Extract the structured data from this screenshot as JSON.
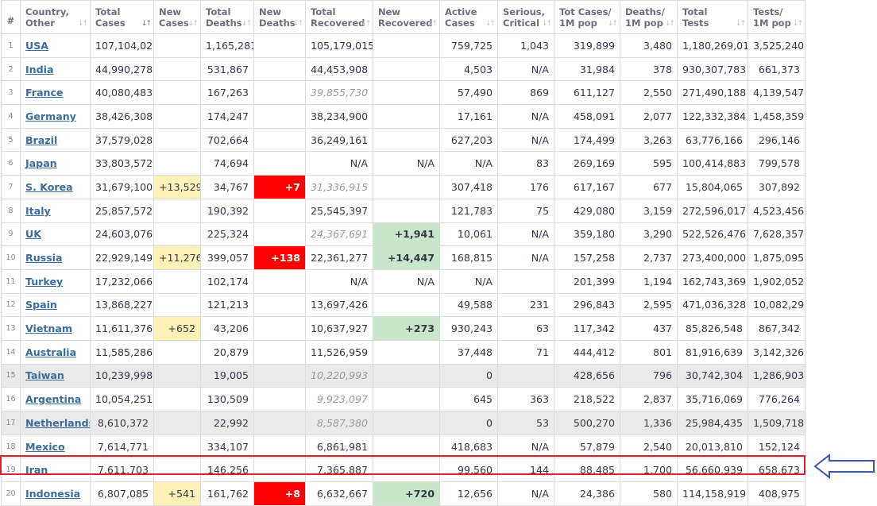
{
  "headers": [
    {
      "label": "#",
      "sortable": false
    },
    {
      "label": "Country,\nOther",
      "sortable": true
    },
    {
      "label": "Total\nCases",
      "sortable": true,
      "sorted": true
    },
    {
      "label": "New\nCases",
      "sortable": true
    },
    {
      "label": "Total\nDeaths",
      "sortable": true
    },
    {
      "label": "New\nDeaths",
      "sortable": true
    },
    {
      "label": "Total\nRecovered",
      "sortable": true
    },
    {
      "label": "New\nRecovered",
      "sortable": true
    },
    {
      "label": "Active\nCases",
      "sortable": true
    },
    {
      "label": "Serious,\nCritical",
      "sortable": true
    },
    {
      "label": "Tot Cases/\n1M pop",
      "sortable": true
    },
    {
      "label": "Deaths/\n1M pop",
      "sortable": true
    },
    {
      "label": "Total\nTests",
      "sortable": true
    },
    {
      "label": "Tests/\n1M pop",
      "sortable": true
    }
  ],
  "sort_icon": "sort-arrows-icon",
  "rows": [
    {
      "num": "1",
      "country": "USA",
      "total_cases": "107,104,021",
      "new_cases": "",
      "total_deaths": "1,165,281",
      "new_deaths": "",
      "total_recovered": "105,179,015",
      "rec_italic": false,
      "new_recovered": "",
      "active_cases": "759,725",
      "serious": "1,043",
      "cases_1m": "319,899",
      "deaths_1m": "3,480",
      "total_tests": "1,180,269,015",
      "tests_1m": "3,525,240",
      "grey": false
    },
    {
      "num": "2",
      "country": "India",
      "total_cases": "44,990,278",
      "new_cases": "",
      "total_deaths": "531,867",
      "new_deaths": "",
      "total_recovered": "44,453,908",
      "rec_italic": false,
      "new_recovered": "",
      "active_cases": "4,503",
      "serious": "N/A",
      "cases_1m": "31,984",
      "deaths_1m": "378",
      "total_tests": "930,307,783",
      "tests_1m": "661,373",
      "grey": false
    },
    {
      "num": "3",
      "country": "France",
      "total_cases": "40,080,483",
      "new_cases": "",
      "total_deaths": "167,263",
      "new_deaths": "",
      "total_recovered": "39,855,730",
      "rec_italic": true,
      "new_recovered": "",
      "active_cases": "57,490",
      "serious": "869",
      "cases_1m": "611,127",
      "deaths_1m": "2,550",
      "total_tests": "271,490,188",
      "tests_1m": "4,139,547",
      "grey": false
    },
    {
      "num": "4",
      "country": "Germany",
      "total_cases": "38,426,308",
      "new_cases": "",
      "total_deaths": "174,247",
      "new_deaths": "",
      "total_recovered": "38,234,900",
      "rec_italic": false,
      "new_recovered": "",
      "active_cases": "17,161",
      "serious": "N/A",
      "cases_1m": "458,091",
      "deaths_1m": "2,077",
      "total_tests": "122,332,384",
      "tests_1m": "1,458,359",
      "grey": false
    },
    {
      "num": "5",
      "country": "Brazil",
      "total_cases": "37,579,028",
      "new_cases": "",
      "total_deaths": "702,664",
      "new_deaths": "",
      "total_recovered": "36,249,161",
      "rec_italic": false,
      "new_recovered": "",
      "active_cases": "627,203",
      "serious": "N/A",
      "cases_1m": "174,499",
      "deaths_1m": "3,263",
      "total_tests": "63,776,166",
      "tests_1m": "296,146",
      "grey": false
    },
    {
      "num": "6",
      "country": "Japan",
      "total_cases": "33,803,572",
      "new_cases": "",
      "total_deaths": "74,694",
      "new_deaths": "",
      "total_recovered": "N/A",
      "rec_italic": false,
      "new_recovered": "N/A",
      "active_cases": "N/A",
      "serious": "83",
      "cases_1m": "269,169",
      "deaths_1m": "595",
      "total_tests": "100,414,883",
      "tests_1m": "799,578",
      "grey": false
    },
    {
      "num": "7",
      "country": "S. Korea",
      "total_cases": "31,679,100",
      "new_cases": "+13,529",
      "total_deaths": "34,767",
      "new_deaths": "+7",
      "total_recovered": "31,336,915",
      "rec_italic": true,
      "new_recovered": "",
      "active_cases": "307,418",
      "serious": "176",
      "cases_1m": "617,167",
      "deaths_1m": "677",
      "total_tests": "15,804,065",
      "tests_1m": "307,892",
      "grey": false
    },
    {
      "num": "8",
      "country": "Italy",
      "total_cases": "25,857,572",
      "new_cases": "",
      "total_deaths": "190,392",
      "new_deaths": "",
      "total_recovered": "25,545,397",
      "rec_italic": false,
      "new_recovered": "",
      "active_cases": "121,783",
      "serious": "75",
      "cases_1m": "429,080",
      "deaths_1m": "3,159",
      "total_tests": "272,596,017",
      "tests_1m": "4,523,456",
      "grey": false
    },
    {
      "num": "9",
      "country": "UK",
      "total_cases": "24,603,076",
      "new_cases": "",
      "total_deaths": "225,324",
      "new_deaths": "",
      "total_recovered": "24,367,691",
      "rec_italic": true,
      "new_recovered": "+1,941",
      "active_cases": "10,061",
      "serious": "N/A",
      "cases_1m": "359,180",
      "deaths_1m": "3,290",
      "total_tests": "522,526,476",
      "tests_1m": "7,628,357",
      "grey": false
    },
    {
      "num": "10",
      "country": "Russia",
      "total_cases": "22,929,149",
      "new_cases": "+11,276",
      "total_deaths": "399,057",
      "new_deaths": "+138",
      "total_recovered": "22,361,277",
      "rec_italic": false,
      "new_recovered": "+14,447",
      "active_cases": "168,815",
      "serious": "N/A",
      "cases_1m": "157,258",
      "deaths_1m": "2,737",
      "total_tests": "273,400,000",
      "tests_1m": "1,875,095",
      "grey": false
    },
    {
      "num": "11",
      "country": "Turkey",
      "total_cases": "17,232,066",
      "new_cases": "",
      "total_deaths": "102,174",
      "new_deaths": "",
      "total_recovered": "N/A",
      "rec_italic": false,
      "new_recovered": "N/A",
      "active_cases": "N/A",
      "serious": "",
      "cases_1m": "201,399",
      "deaths_1m": "1,194",
      "total_tests": "162,743,369",
      "tests_1m": "1,902,052",
      "grey": false
    },
    {
      "num": "12",
      "country": "Spain",
      "total_cases": "13,868,227",
      "new_cases": "",
      "total_deaths": "121,213",
      "new_deaths": "",
      "total_recovered": "13,697,426",
      "rec_italic": false,
      "new_recovered": "",
      "active_cases": "49,588",
      "serious": "231",
      "cases_1m": "296,843",
      "deaths_1m": "2,595",
      "total_tests": "471,036,328",
      "tests_1m": "10,082,298",
      "grey": false
    },
    {
      "num": "13",
      "country": "Vietnam",
      "total_cases": "11,611,376",
      "new_cases": "+652",
      "total_deaths": "43,206",
      "new_deaths": "",
      "total_recovered": "10,637,927",
      "rec_italic": false,
      "new_recovered": "+273",
      "active_cases": "930,243",
      "serious": "63",
      "cases_1m": "117,342",
      "deaths_1m": "437",
      "total_tests": "85,826,548",
      "tests_1m": "867,342",
      "grey": false
    },
    {
      "num": "14",
      "country": "Australia",
      "total_cases": "11,585,286",
      "new_cases": "",
      "total_deaths": "20,879",
      "new_deaths": "",
      "total_recovered": "11,526,959",
      "rec_italic": false,
      "new_recovered": "",
      "active_cases": "37,448",
      "serious": "71",
      "cases_1m": "444,412",
      "deaths_1m": "801",
      "total_tests": "81,916,639",
      "tests_1m": "3,142,326",
      "grey": false
    },
    {
      "num": "15",
      "country": "Taiwan",
      "total_cases": "10,239,998",
      "new_cases": "",
      "total_deaths": "19,005",
      "new_deaths": "",
      "total_recovered": "10,220,993",
      "rec_italic": true,
      "new_recovered": "",
      "active_cases": "0",
      "serious": "",
      "cases_1m": "428,656",
      "deaths_1m": "796",
      "total_tests": "30,742,304",
      "tests_1m": "1,286,903",
      "grey": true
    },
    {
      "num": "16",
      "country": "Argentina",
      "total_cases": "10,054,251",
      "new_cases": "",
      "total_deaths": "130,509",
      "new_deaths": "",
      "total_recovered": "9,923,097",
      "rec_italic": true,
      "new_recovered": "",
      "active_cases": "645",
      "serious": "363",
      "cases_1m": "218,522",
      "deaths_1m": "2,837",
      "total_tests": "35,716,069",
      "tests_1m": "776,264",
      "grey": false
    },
    {
      "num": "17",
      "country": "Netherlands",
      "total_cases": "8,610,372",
      "new_cases": "",
      "total_deaths": "22,992",
      "new_deaths": "",
      "total_recovered": "8,587,380",
      "rec_italic": true,
      "new_recovered": "",
      "active_cases": "0",
      "serious": "53",
      "cases_1m": "500,270",
      "deaths_1m": "1,336",
      "total_tests": "25,984,435",
      "tests_1m": "1,509,718",
      "grey": true
    },
    {
      "num": "18",
      "country": "Mexico",
      "total_cases": "7,614,771",
      "new_cases": "",
      "total_deaths": "334,107",
      "new_deaths": "",
      "total_recovered": "6,861,981",
      "rec_italic": false,
      "new_recovered": "",
      "active_cases": "418,683",
      "serious": "N/A",
      "cases_1m": "57,879",
      "deaths_1m": "2,540",
      "total_tests": "20,013,810",
      "tests_1m": "152,124",
      "grey": false
    },
    {
      "num": "19",
      "country": "Iran",
      "total_cases": "7,611,703",
      "new_cases": "",
      "total_deaths": "146,256",
      "new_deaths": "",
      "total_recovered": "7,365,887",
      "rec_italic": false,
      "new_recovered": "",
      "active_cases": "99,560",
      "serious": "144",
      "cases_1m": "88,485",
      "deaths_1m": "1,700",
      "total_tests": "56,660,939",
      "tests_1m": "658,673",
      "grey": false
    },
    {
      "num": "20",
      "country": "Indonesia",
      "total_cases": "6,807,085",
      "new_cases": "+541",
      "total_deaths": "161,762",
      "new_deaths": "+8",
      "total_recovered": "6,632,667",
      "rec_italic": false,
      "new_recovered": "+720",
      "active_cases": "12,656",
      "serious": "N/A",
      "cases_1m": "24,386",
      "deaths_1m": "580",
      "total_tests": "114,158,919",
      "tests_1m": "408,975",
      "grey": false
    }
  ],
  "highlight": {
    "row_index": 19,
    "box_color": "#d8202f",
    "arrow_color": "#3b55b3",
    "arrow_icon": "left-arrow-icon"
  },
  "colors": {
    "new_cases_bg": "#fdf1b6",
    "new_deaths_bg": "#ff0000",
    "new_recovered_bg": "#c8e6c9",
    "link": "#3b6c9e",
    "grey_row": "#eaeaea"
  }
}
